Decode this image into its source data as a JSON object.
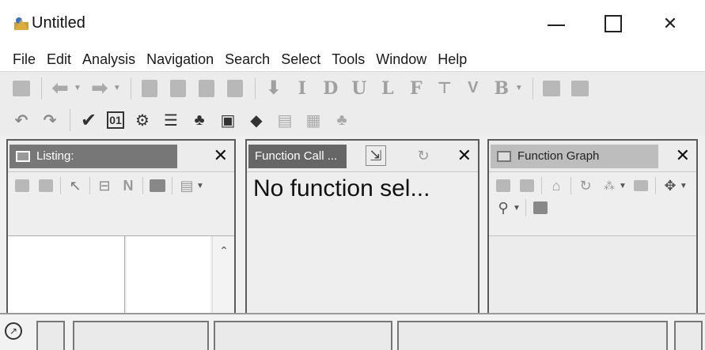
{
  "window": {
    "title": "Untitled",
    "min_label": "",
    "max_label": "",
    "close_label": "✕"
  },
  "menu": [
    "File",
    "Edit",
    "Analysis",
    "Navigation",
    "Search",
    "Select",
    "Tools",
    "Window",
    "Help"
  ],
  "toolbar_letters": [
    "I",
    "D",
    "U",
    "L",
    "F",
    "B"
  ],
  "panels": {
    "listing": {
      "title": "Listing:",
      "close": "✕"
    },
    "function_call": {
      "title": "Function Call ...",
      "close": "✕",
      "message": "No function sel..."
    },
    "function_graph": {
      "title": "Function Graph",
      "close": "✕"
    }
  },
  "icons": {
    "save": "save-icon",
    "back": "back-arrow-icon",
    "forward": "forward-arrow-icon",
    "undo": "undo-icon",
    "redo": "redo-icon"
  }
}
